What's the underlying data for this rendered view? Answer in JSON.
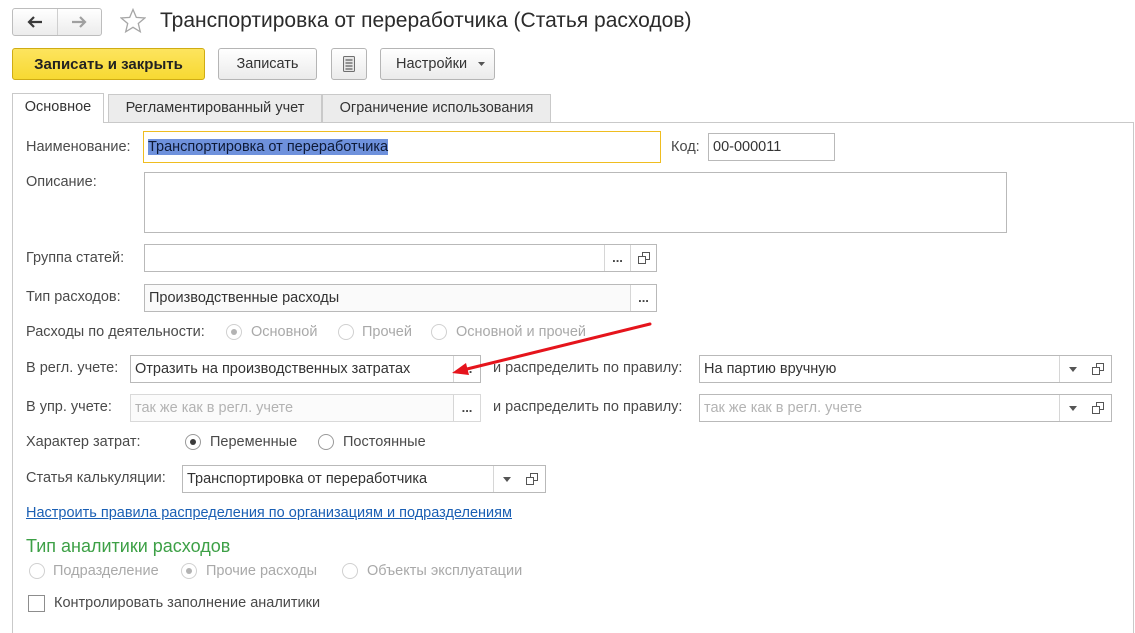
{
  "window": {
    "title": "Транспортировка от переработчика (Статья расходов)"
  },
  "icons": {
    "back": "arrow-left-icon",
    "forward": "arrow-right-icon",
    "favorite": "star-icon",
    "list": "list-icon",
    "dropdown": "dropdown-arrow-icon",
    "open": "open-icon"
  },
  "toolbar": {
    "save_close_label": "Записать и закрыть",
    "save_label": "Записать",
    "settings_label": "Настройки"
  },
  "tabs": [
    {
      "label": "Основное",
      "active": true
    },
    {
      "label": "Регламентированный учет",
      "active": false
    },
    {
      "label": "Ограничение использования",
      "active": false
    }
  ],
  "form": {
    "ellipsis": "...",
    "name": {
      "label": "Наименование:",
      "value": "Транспортировка от переработчика"
    },
    "code": {
      "label": "Код:",
      "value": "00-000011"
    },
    "description": {
      "label": "Описание:",
      "value": ""
    },
    "group": {
      "label": "Группа статей:",
      "value": ""
    },
    "expense_type": {
      "label": "Тип расходов:",
      "value": "Производственные расходы"
    },
    "activity": {
      "label": "Расходы по деятельности:",
      "options": [
        "Основной",
        "Прочей",
        "Основной и прочей"
      ],
      "selected": "Основной",
      "disabled": true
    },
    "reg_accounting": {
      "label": "В регл. учете:",
      "value": "Отразить на производственных затратах",
      "rule_label": "и распределить по правилу:",
      "rule_value": "На партию вручную"
    },
    "mgmt_accounting": {
      "label": "В упр. учете:",
      "placeholder": "так же как в регл. учете",
      "rule_label": "и распределить по правилу:",
      "rule_placeholder": "так же как в регл. учете"
    },
    "cost_nature": {
      "label": "Характер затрат:",
      "options": [
        "Переменные",
        "Постоянные"
      ],
      "selected": "Переменные",
      "disabled": false
    },
    "calc_item": {
      "label": "Статья калькуляции:",
      "value": "Транспортировка от переработчика"
    },
    "distribution_link": "Настроить правила распределения по организациям и подразделениям",
    "analytics": {
      "title": "Тип аналитики расходов",
      "options": [
        "Подразделение",
        "Прочие расходы",
        "Объекты эксплуатации"
      ],
      "selected": "Прочие расходы",
      "disabled": true
    },
    "control_checkbox": {
      "label": "Контролировать заполнение аналитики",
      "checked": false
    }
  },
  "colors": {
    "accent_button": "#f7d932",
    "focus_border": "#efbd20",
    "selection": "#6e91dc",
    "link": "#1a5fb4",
    "group_header": "#3da046",
    "annotation_arrow": "#e5141c"
  }
}
